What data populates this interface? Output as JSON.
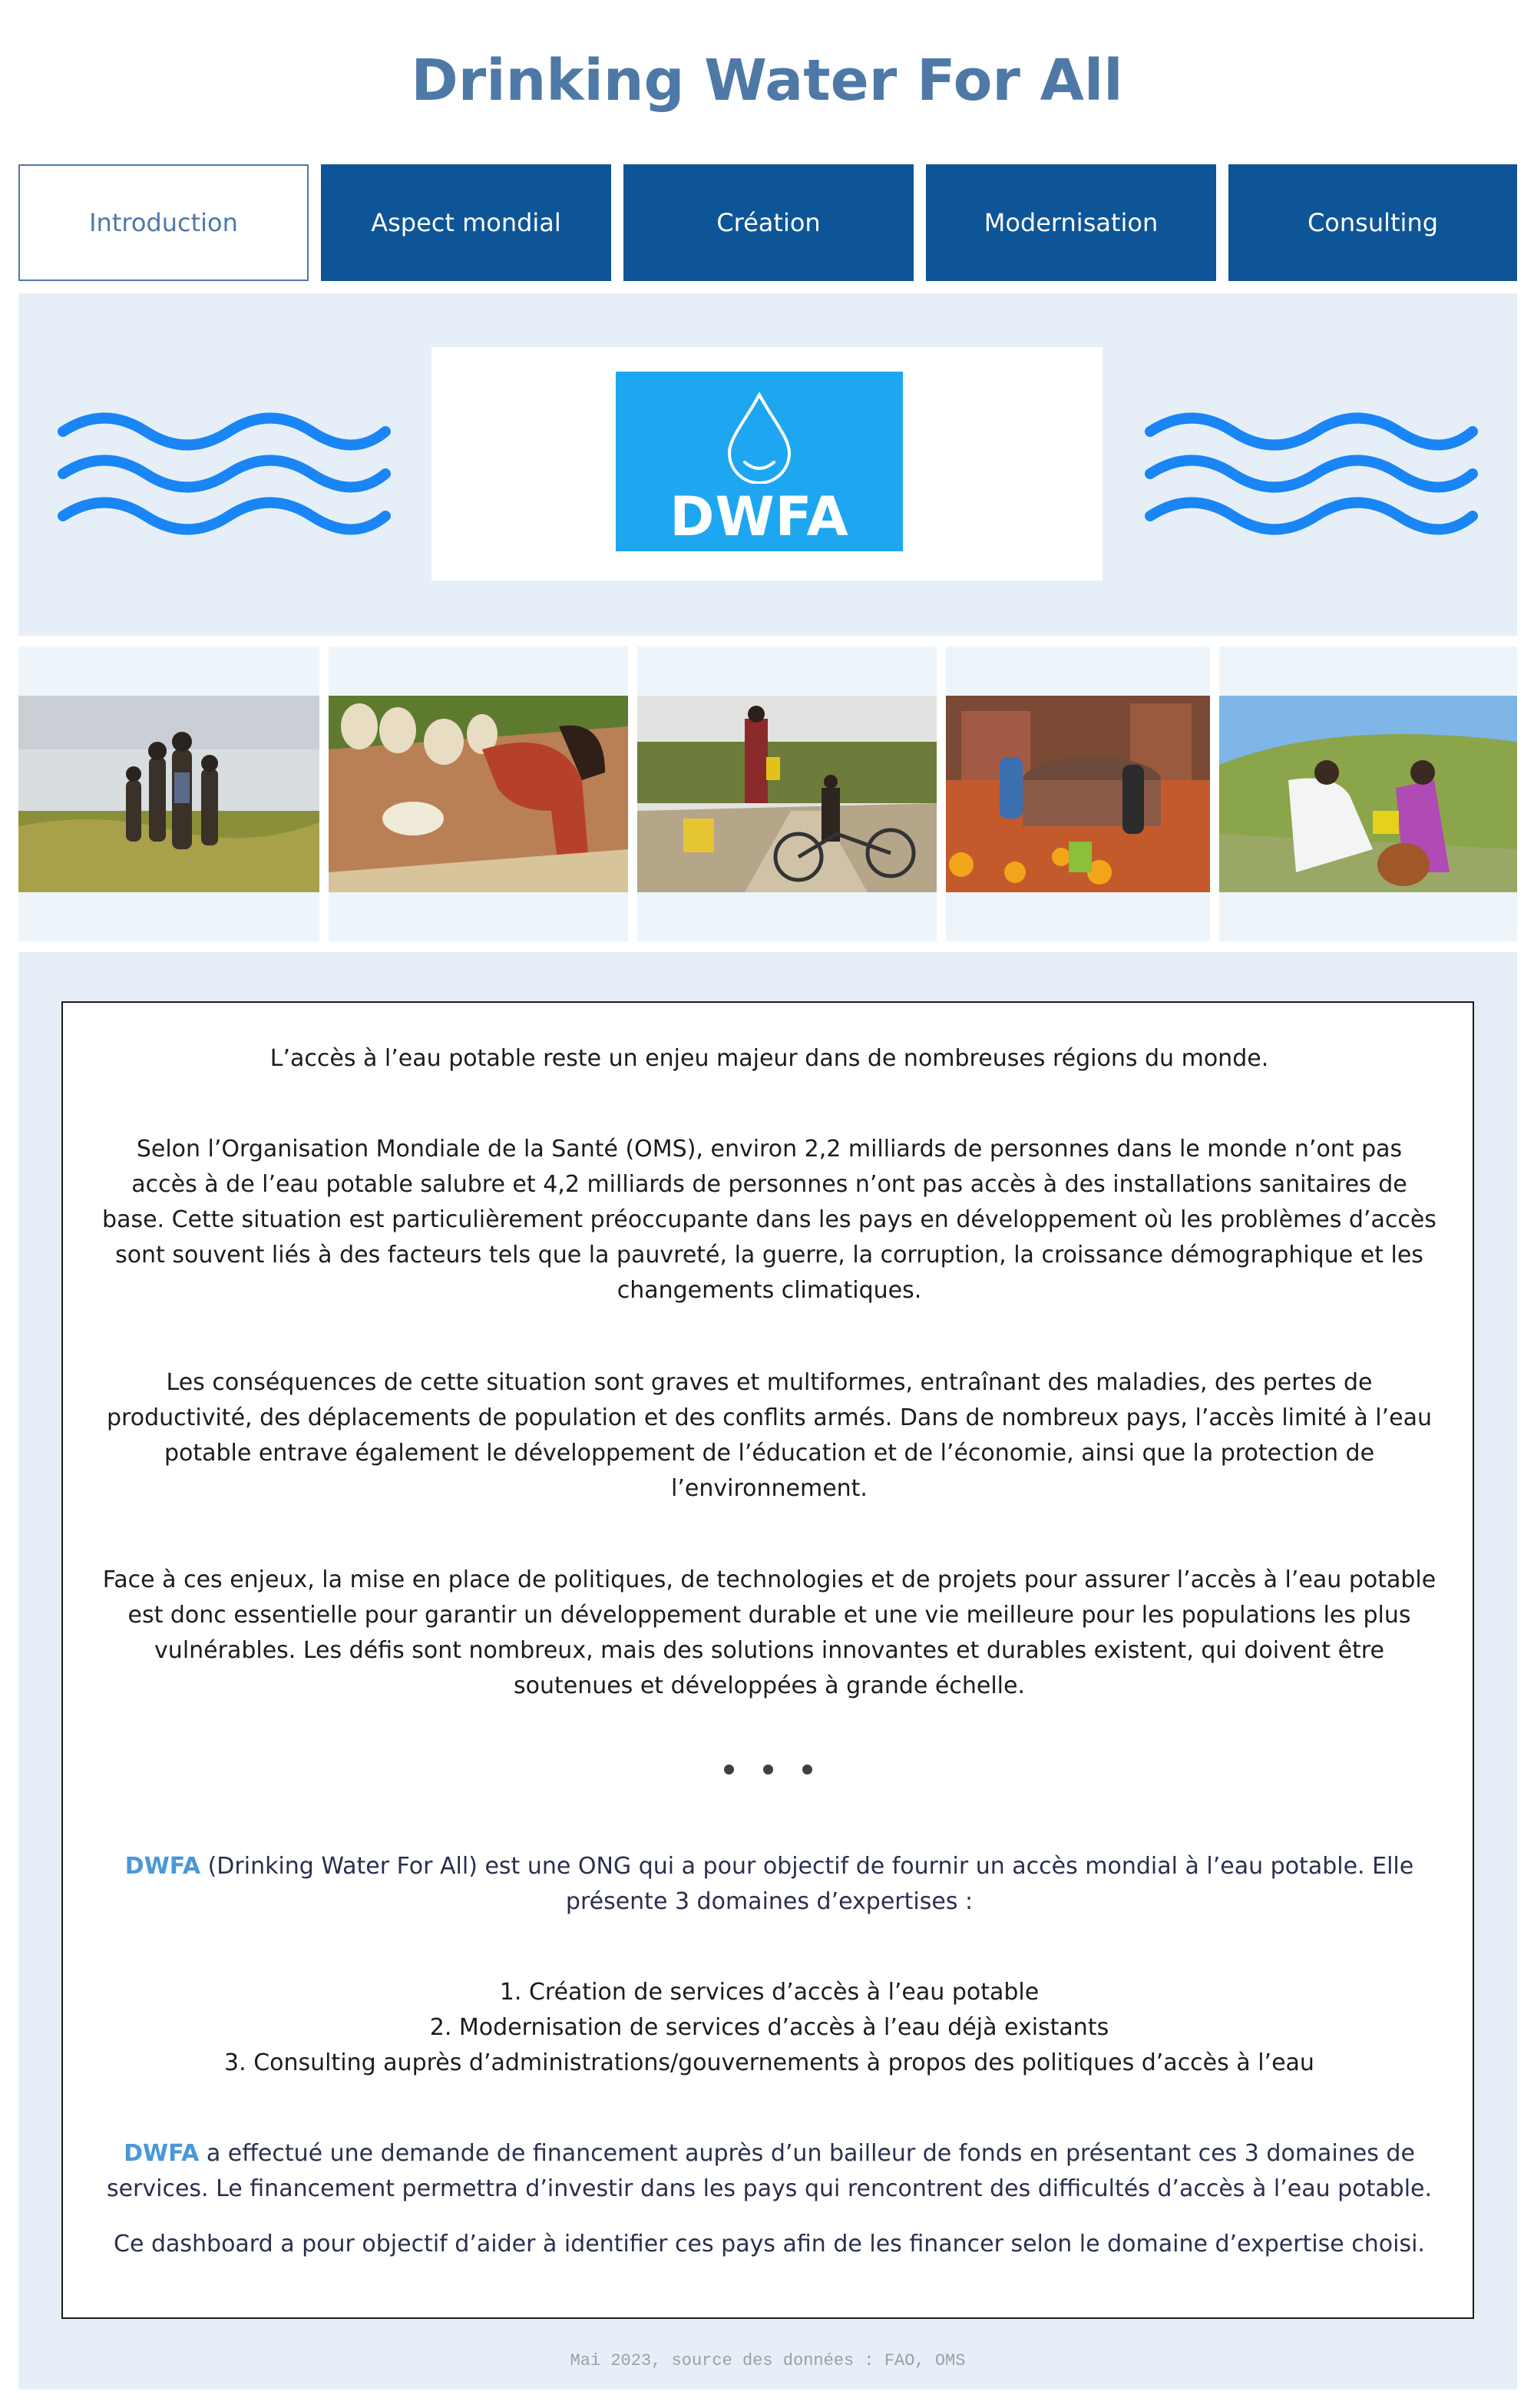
{
  "header": {
    "title": "Drinking Water For All"
  },
  "tabs": [
    {
      "label": "Introduction",
      "active": true
    },
    {
      "label": "Aspect mondial",
      "active": false
    },
    {
      "label": "Création",
      "active": false
    },
    {
      "label": "Modernisation",
      "active": false
    },
    {
      "label": "Consulting",
      "active": false
    }
  ],
  "hero": {
    "logo_text": "DWFA",
    "accent_color": "#1ea7f0",
    "wave_color": "#1a85f5"
  },
  "photos": [
    {
      "name": "children-in-field-photo"
    },
    {
      "name": "woman-collecting-grain-photo"
    },
    {
      "name": "child-with-bicycle-water-cans-photo"
    },
    {
      "name": "people-at-well-photo"
    },
    {
      "name": "pouring-water-photo"
    }
  ],
  "intro": {
    "p1": "L’accès à l’eau potable reste un enjeu majeur dans de nombreuses régions du monde.",
    "p2": "Selon l’Organisation Mondiale de la Santé (OMS), environ 2,2 milliards de personnes dans le monde n’ont pas accès à de l’eau potable salubre et 4,2 milliards de personnes n’ont pas accès à des installations sanitaires de base. Cette situation est particulièrement préoccupante dans les pays en développement où les problèmes d’accès sont souvent liés à des facteurs tels que la pauvreté, la guerre, la corruption, la croissance démographique et les changements climatiques.",
    "p3": "Les conséquences de cette situation sont graves et multiformes, entraînant des maladies, des pertes de productivité, des déplacements de population et des conflits armés. Dans de nombreux pays, l’accès limité à l’eau potable entrave également le développement de l’éducation et de l’économie, ainsi que la protection de l’environnement.",
    "p4": "Face à ces enjeux, la mise en place de politiques, de technologies et de projets pour assurer l’accès à l’eau potable est donc essentielle pour garantir un développement durable et une vie meilleure pour les populations les plus vulnérables. Les défis sont nombreux, mais des solutions innovantes et durables existent, qui doivent être soutenues et développées à grande échelle.",
    "org_name": "DWFA",
    "p5_rest": " (Drinking Water For All) est une ONG qui a pour objectif de fournir un accès mondial à l’eau potable. Elle présente 3 domaines d’expertises :",
    "domains": [
      "1. Création de services d’accès à l’eau potable",
      "2. Modernisation de services d’accès à l’eau déjà existants",
      "3. Consulting auprès d’administrations/gouvernements à propos des politiques d’accès à l’eau"
    ],
    "p6_rest": " a effectué une demande de financement auprès d’un bailleur de fonds en présentant ces 3 domaines de services. Le financement permettra d’investir dans les pays qui rencontrent des difficultés d’accès à l’eau potable.",
    "p7": "Ce dashboard a pour objectif d’aider à identifier ces pays afin de les financer selon le domaine d’expertise choisi."
  },
  "footer": {
    "text": "Mai 2023, source des données : FAO, OMS"
  }
}
